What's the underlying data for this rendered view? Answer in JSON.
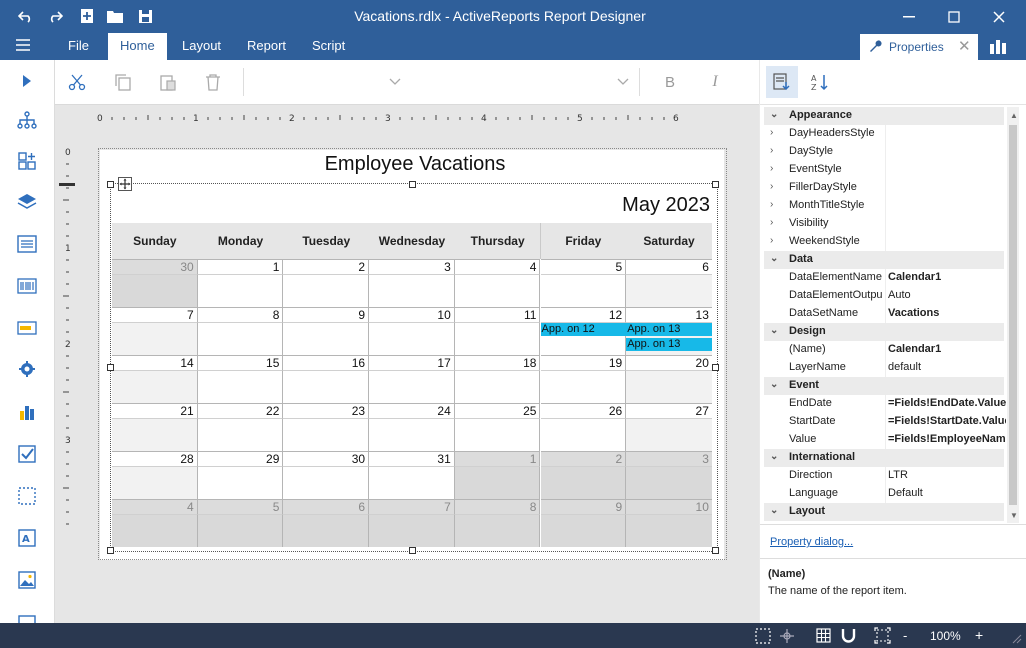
{
  "window": {
    "title": "Vacations.rdlx -  ActiveReports Report Designer"
  },
  "menu": {
    "items": [
      "File",
      "Home",
      "Layout",
      "Report",
      "Script"
    ],
    "active": "Home",
    "properties_tab": "Properties"
  },
  "ribbon": {
    "bold": "B",
    "italic": "I"
  },
  "ruler": {
    "h_ticks": [
      "0",
      "1",
      "2",
      "3",
      "4",
      "5",
      "6"
    ],
    "v_ticks": [
      "0",
      "1",
      "2",
      "3"
    ]
  },
  "report": {
    "title": "Employee Vacations",
    "month_title": "May 2023",
    "day_headers": [
      "Sunday",
      "Monday",
      "Tuesday",
      "Wednesday",
      "Thursday",
      "Friday",
      "Saturday"
    ],
    "weeks": [
      [
        "30",
        "1",
        "2",
        "3",
        "4",
        "5",
        "6"
      ],
      [
        "7",
        "8",
        "9",
        "10",
        "11",
        "12",
        "13"
      ],
      [
        "14",
        "15",
        "16",
        "17",
        "18",
        "19",
        "20"
      ],
      [
        "21",
        "22",
        "23",
        "24",
        "25",
        "26",
        "27"
      ],
      [
        "28",
        "29",
        "30",
        "31",
        "1",
        "2",
        "3"
      ],
      [
        "4",
        "5",
        "6",
        "7",
        "8",
        "9",
        "10"
      ]
    ],
    "events": [
      {
        "label": "App. on 12",
        "week": 1,
        "day": 5,
        "slot": 0
      },
      {
        "label": "App. on 13",
        "week": 1,
        "day": 6,
        "slot": 0
      },
      {
        "label": "App. on 13",
        "week": 1,
        "day": 6,
        "slot": 1
      }
    ]
  },
  "properties": {
    "rows": [
      {
        "kind": "cat",
        "name": "Appearance"
      },
      {
        "kind": "prop",
        "name": "DayHeadersStyle",
        "value": "",
        "expandable": true
      },
      {
        "kind": "prop",
        "name": "DayStyle",
        "value": "",
        "expandable": true
      },
      {
        "kind": "prop",
        "name": "EventStyle",
        "value": "",
        "expandable": true
      },
      {
        "kind": "prop",
        "name": "FillerDayStyle",
        "value": "",
        "expandable": true
      },
      {
        "kind": "prop",
        "name": "MonthTitleStyle",
        "value": "",
        "expandable": true
      },
      {
        "kind": "prop",
        "name": "Visibility",
        "value": "",
        "expandable": true
      },
      {
        "kind": "prop",
        "name": "WeekendStyle",
        "value": "",
        "expandable": true
      },
      {
        "kind": "cat",
        "name": "Data"
      },
      {
        "kind": "prop",
        "name": "DataElementName",
        "value": "Calendar1",
        "bold": true
      },
      {
        "kind": "prop",
        "name": "DataElementOutpu",
        "value": "Auto"
      },
      {
        "kind": "prop",
        "name": "DataSetName",
        "value": "Vacations",
        "bold": true
      },
      {
        "kind": "cat",
        "name": "Design"
      },
      {
        "kind": "prop",
        "name": "(Name)",
        "value": "Calendar1",
        "bold": true
      },
      {
        "kind": "prop",
        "name": "LayerName",
        "value": "default"
      },
      {
        "kind": "cat",
        "name": "Event"
      },
      {
        "kind": "prop",
        "name": "EndDate",
        "value": "=Fields!EndDate.Value",
        "bold": true
      },
      {
        "kind": "prop",
        "name": "StartDate",
        "value": "=Fields!StartDate.Value",
        "bold": true
      },
      {
        "kind": "prop",
        "name": "Value",
        "value": "=Fields!EmployeeName",
        "bold": true
      },
      {
        "kind": "cat",
        "name": "International"
      },
      {
        "kind": "prop",
        "name": "Direction",
        "value": "LTR"
      },
      {
        "kind": "prop",
        "name": "Language",
        "value": "Default"
      },
      {
        "kind": "cat",
        "name": "Layout"
      }
    ],
    "dialog_link": "Property dialog...",
    "help_title": "(Name)",
    "help_text": "The name of the report item."
  },
  "statusbar": {
    "zoom": "100%",
    "minus": "-",
    "plus": "+"
  },
  "colors": {
    "chrome": "#2f5f9a",
    "status": "#2a3850",
    "event": "#17b9e8",
    "toolbox_icon": "#2f6fbd"
  }
}
